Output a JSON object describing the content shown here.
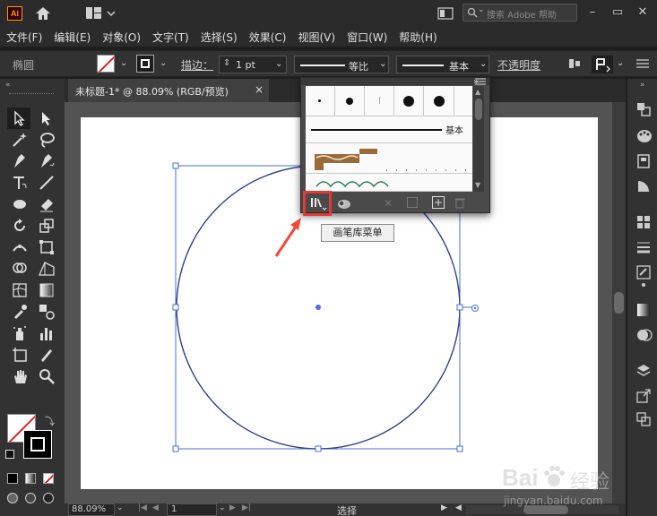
{
  "app": {
    "logo_text": "Ai"
  },
  "topbar": {
    "search_placeholder": "搜索 Adobe 帮助"
  },
  "menu": {
    "items": [
      "文件(F)",
      "编辑(E)",
      "对象(O)",
      "文字(T)",
      "选择(S)",
      "效果(C)",
      "视图(V)",
      "窗口(W)",
      "帮助(H)"
    ]
  },
  "controlbar": {
    "object_type": "椭圆",
    "stroke_label": "描边：",
    "stroke_value": "1 pt",
    "profile_label": "等比",
    "brush_label": "基本",
    "opacity_label": "不透明度"
  },
  "document": {
    "tab_title": "未标题-1* @ 88.09% (RGB/预览)",
    "close_glyph": "×"
  },
  "brush_panel": {
    "basic_label": "基本",
    "tooltip": "画笔库菜单"
  },
  "statusbar": {
    "zoom": "88.09%",
    "page": "1",
    "mode": "选择"
  },
  "watermark": {
    "brand": "Bai",
    "brand2": "经验",
    "url": "jingyan.baidu.com"
  },
  "colors": {
    "accent_selection": "#4a6fd6",
    "highlight": "#e53935",
    "arrow": "#ef4a35"
  }
}
